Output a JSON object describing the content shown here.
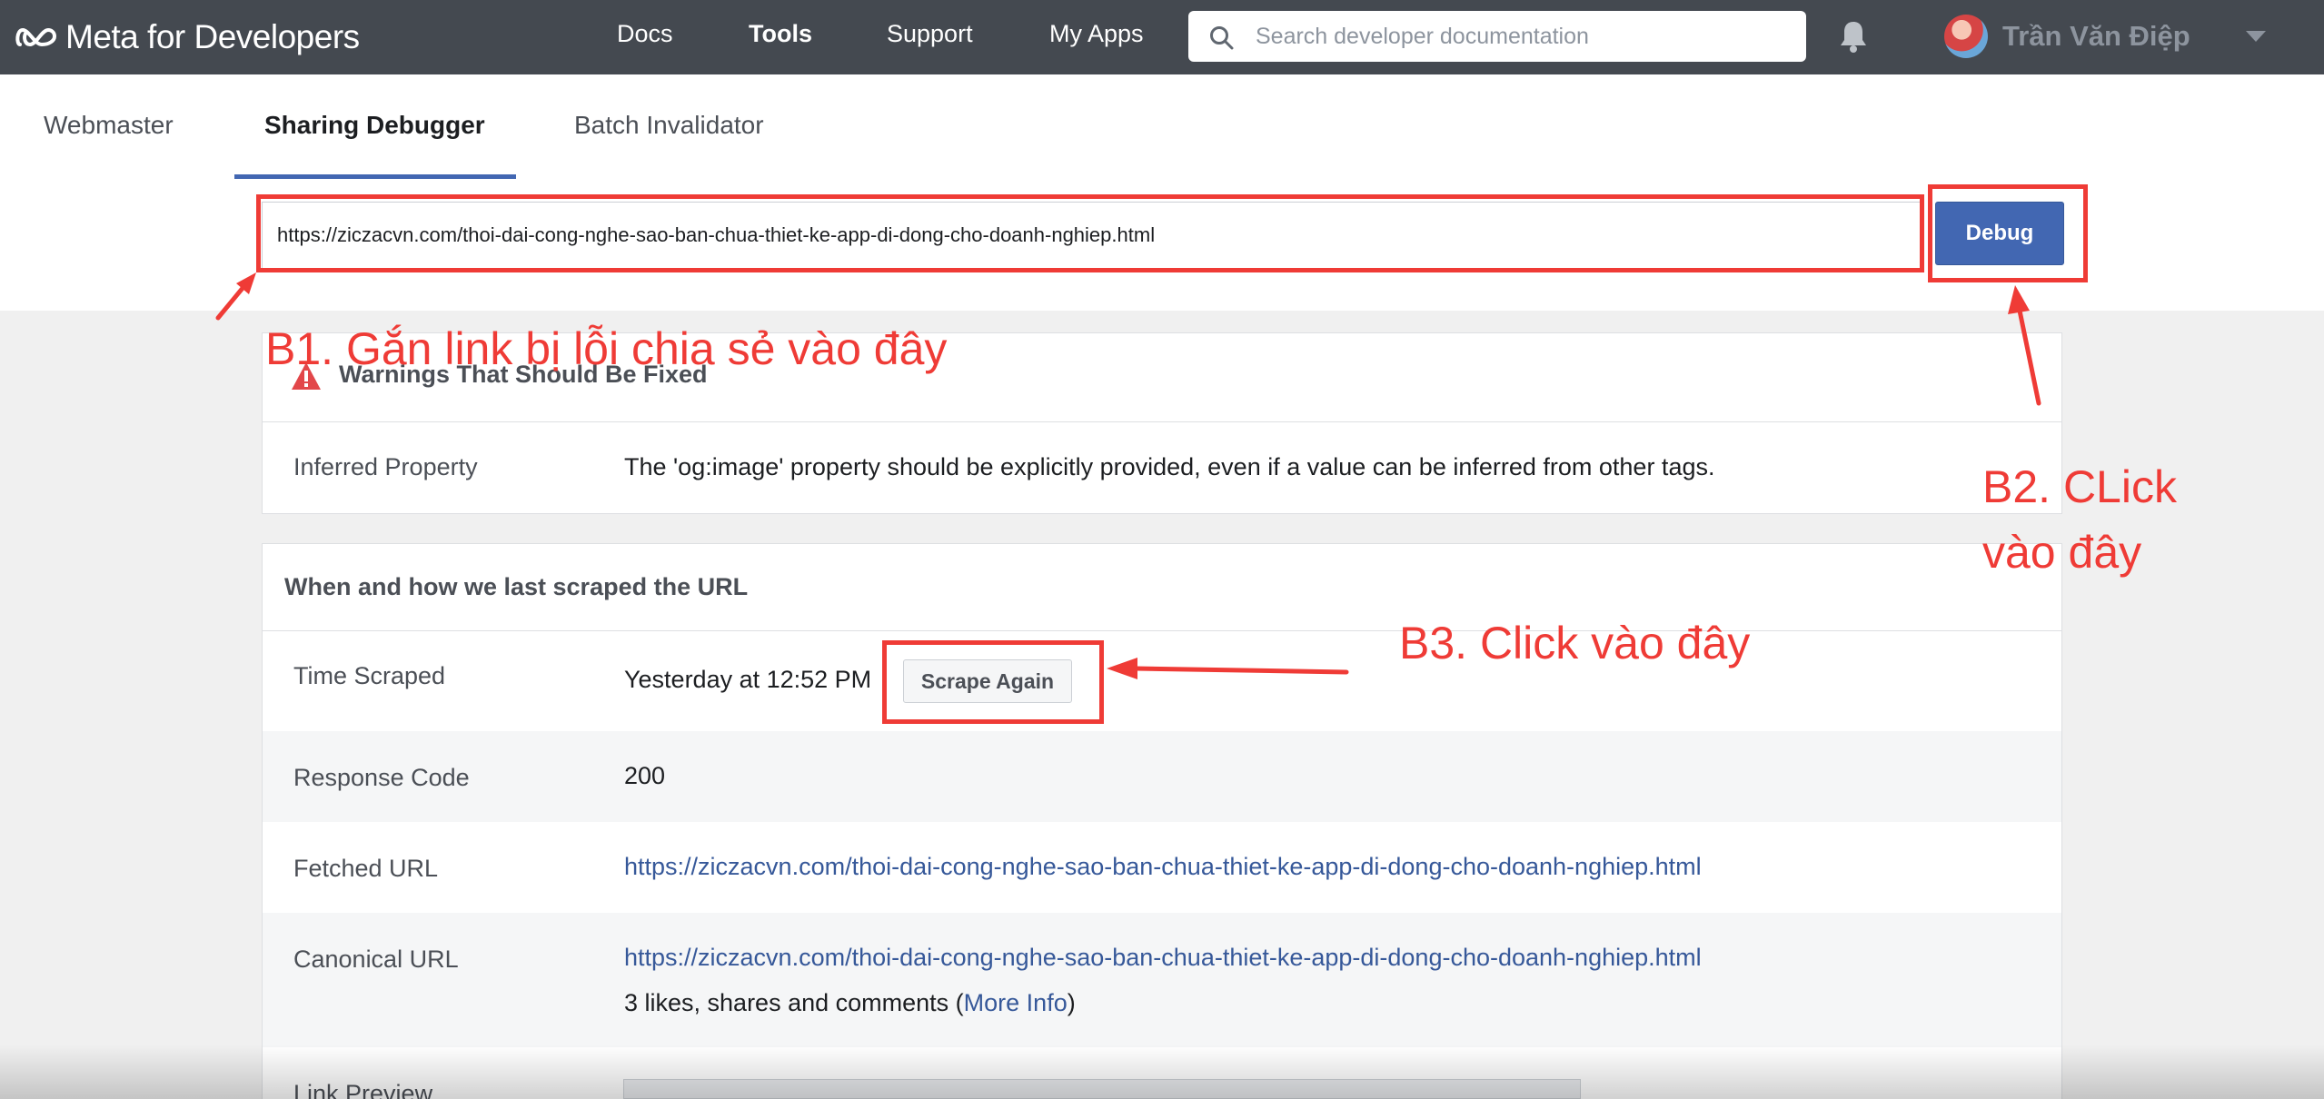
{
  "nav": {
    "brand": "Meta for Developers",
    "links": [
      "Docs",
      "Tools",
      "Support",
      "My Apps"
    ],
    "search_placeholder": "Search developer documentation",
    "username": "Trần Văn Điệp"
  },
  "tabs": [
    "Webmaster",
    "Sharing Debugger",
    "Batch Invalidator"
  ],
  "active_tab": "Sharing Debugger",
  "debug": {
    "url": "https://ziczacvn.com/thoi-dai-cong-nghe-sao-ban-chua-thiet-ke-app-di-dong-cho-doanh-nghiep.html",
    "button": "Debug"
  },
  "warnings": {
    "title": "Warnings That Should Be Fixed",
    "rows": [
      {
        "label": "Inferred Property",
        "value": "The 'og:image' property should be explicitly provided, even if a value can be inferred from other tags."
      }
    ]
  },
  "scrape": {
    "title": "When and how we last scraped the URL",
    "time_label": "Time Scraped",
    "time_value": "Yesterday at 12:52 PM",
    "scrape_button": "Scrape Again",
    "response_label": "Response Code",
    "response_value": "200",
    "fetched_label": "Fetched URL",
    "fetched_value": "https://ziczacvn.com/thoi-dai-cong-nghe-sao-ban-chua-thiet-ke-app-di-dong-cho-doanh-nghiep.html",
    "canonical_label": "Canonical URL",
    "canonical_value": "https://ziczacvn.com/thoi-dai-cong-nghe-sao-ban-chua-thiet-ke-app-di-dong-cho-doanh-nghiep.html",
    "likes_prefix": "3 likes, shares and comments (",
    "more_info": "More Info",
    "likes_suffix": ")",
    "preview_label": "Link Preview"
  },
  "annotations": {
    "b1": "B1. Gắn link bị lỗi chia sẻ vào đây",
    "b2_line1": "B2. CLick",
    "b2_line2": "vào đây",
    "b3": "B3. Click vào đây"
  },
  "colors": {
    "nav_bg": "#444950",
    "accent": "#4267b2",
    "link": "#365899",
    "annotation": "#ef3b36"
  }
}
